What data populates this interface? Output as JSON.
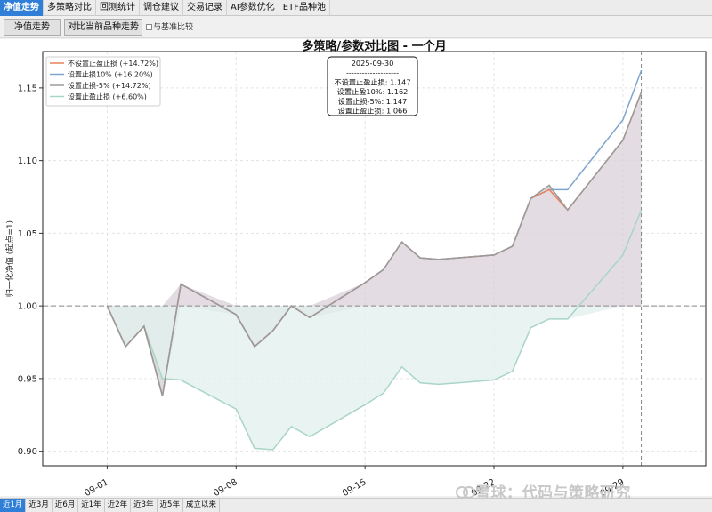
{
  "tabs": [
    {
      "label": "净值走势",
      "active": true
    },
    {
      "label": "多策略对比",
      "active": false
    },
    {
      "label": "回测统计",
      "active": false
    },
    {
      "label": "调仓建议",
      "active": false
    },
    {
      "label": "交易记录",
      "active": false
    },
    {
      "label": "AI参数优化",
      "active": false
    },
    {
      "label": "ETF品种池",
      "active": false
    }
  ],
  "toolbar": {
    "nav_button": "净值走势",
    "compare_button": "对比当前品种走势",
    "benchmark_checkbox": "与基准比较",
    "benchmark_checked": false
  },
  "range_buttons": [
    {
      "label": "近1月",
      "active": true
    },
    {
      "label": "近3月",
      "active": false
    },
    {
      "label": "近6月",
      "active": false
    },
    {
      "label": "近1年",
      "active": false
    },
    {
      "label": "近2年",
      "active": false
    },
    {
      "label": "近3年",
      "active": false
    },
    {
      "label": "近5年",
      "active": false
    },
    {
      "label": "成立以来",
      "active": false
    }
  ],
  "watermark": "雪球：代码与策略研究",
  "colors": {
    "accent": "#2f7fd8",
    "series_no_stop": "#e8835a",
    "series_stop10": "#7fa5cf",
    "series_stop5": "#9a9a9a",
    "series_stop_only": "#a8d5c8",
    "fill_above": "#d9d0da",
    "fill_below_gray": "#cfcfcf",
    "fill_below_teal": "#e4f0ee"
  },
  "chart_data": {
    "type": "line",
    "title": "多策略/参数对比图 - 一个月",
    "xlabel": "",
    "ylabel": "归一化净值 (起点=1)",
    "xtick_labels": [
      "09-01",
      "09-08",
      "09-15",
      "09-22",
      "09-29"
    ],
    "xtick_dates": [
      "2025-09-01",
      "2025-09-08",
      "2025-09-15",
      "2025-09-22",
      "2025-09-29"
    ],
    "x": [
      "2025-09-01",
      "2025-09-02",
      "2025-09-03",
      "2025-09-04",
      "2025-09-05",
      "2025-09-08",
      "2025-09-09",
      "2025-09-10",
      "2025-09-11",
      "2025-09-12",
      "2025-09-15",
      "2025-09-16",
      "2025-09-17",
      "2025-09-18",
      "2025-09-19",
      "2025-09-22",
      "2025-09-23",
      "2025-09-24",
      "2025-09-25",
      "2025-09-26",
      "2025-09-29",
      "2025-09-30"
    ],
    "ylim": [
      0.89,
      1.175
    ],
    "yticks": [
      0.9,
      0.95,
      1.0,
      1.05,
      1.1,
      1.15
    ],
    "baseline": 1.0,
    "grid": true,
    "legend_position": "top-left",
    "series": [
      {
        "name": "不设置止盈止损 (+14.72%)",
        "color": "#e8835a",
        "values": [
          1.0,
          0.972,
          0.986,
          0.938,
          1.015,
          0.994,
          0.972,
          0.983,
          1.0,
          0.992,
          1.016,
          1.025,
          1.044,
          1.033,
          1.032,
          1.035,
          1.041,
          1.074,
          1.08,
          1.066,
          1.114,
          1.147
        ]
      },
      {
        "name": "设置止损10% (+16.20%)",
        "color": "#7fa5cf",
        "values": [
          1.0,
          0.972,
          0.986,
          0.938,
          1.015,
          0.994,
          0.972,
          0.983,
          1.0,
          0.992,
          1.016,
          1.025,
          1.044,
          1.033,
          1.032,
          1.035,
          1.041,
          1.074,
          1.08,
          1.08,
          1.128,
          1.162
        ]
      },
      {
        "name": "设置止损-5% (+14.72%)",
        "color": "#9a9a9a",
        "values": [
          1.0,
          0.972,
          0.986,
          0.938,
          1.015,
          0.994,
          0.972,
          0.983,
          1.0,
          0.992,
          1.016,
          1.025,
          1.044,
          1.033,
          1.032,
          1.035,
          1.041,
          1.074,
          1.083,
          1.066,
          1.114,
          1.147
        ]
      },
      {
        "name": "设置止盈止损 (+6.60%)",
        "color": "#a8d5c8",
        "values": [
          1.0,
          0.972,
          0.986,
          0.95,
          0.949,
          0.929,
          0.902,
          0.901,
          0.917,
          0.91,
          0.932,
          0.94,
          0.958,
          0.947,
          0.946,
          0.949,
          0.955,
          0.985,
          0.991,
          0.991,
          1.035,
          1.066
        ]
      }
    ],
    "annotation": {
      "date": "2025-09-30",
      "separator": "--------------------",
      "lines": [
        "不设置止盈止损: 1.147",
        "设置止盈10%: 1.162",
        "设置止损-5%: 1.147",
        "设置止盈止损: 1.066"
      ]
    }
  }
}
